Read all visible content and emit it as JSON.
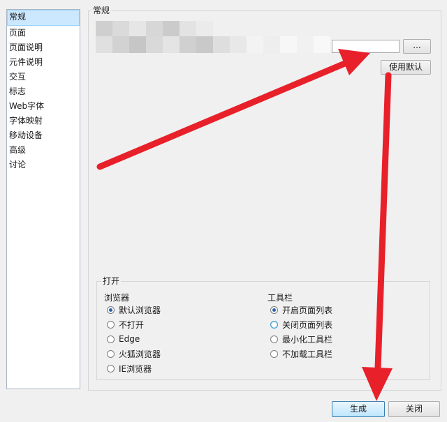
{
  "sidebar": {
    "items": [
      {
        "label": "常规",
        "selected": true
      },
      {
        "label": "页面"
      },
      {
        "label": "页面说明"
      },
      {
        "label": "元件说明"
      },
      {
        "label": "交互"
      },
      {
        "label": "标志"
      },
      {
        "label": "Web字体"
      },
      {
        "label": "字体映射"
      },
      {
        "label": "移动设备"
      },
      {
        "label": "高级"
      },
      {
        "label": "讨论"
      }
    ]
  },
  "general": {
    "title": "常规",
    "path_value": "",
    "browse_label": "...",
    "use_default_label": "使用默认"
  },
  "open": {
    "title": "打开",
    "browser": {
      "title": "浏览器",
      "options": [
        "默认浏览器",
        "不打开",
        "Edge",
        "火狐浏览器",
        "IE浏览器"
      ],
      "selected": "默认浏览器"
    },
    "toolbar": {
      "title": "工具栏",
      "options": [
        "开启页面列表",
        "关闭页面列表",
        "最小化工具栏",
        "不加载工具栏"
      ],
      "selected": "开启页面列表"
    }
  },
  "footer": {
    "generate_label": "生成",
    "close_label": "关闭"
  },
  "colors": {
    "arrow": "#e8202a",
    "selection": "#cce8ff",
    "radio_dot": "#2a64a8"
  }
}
